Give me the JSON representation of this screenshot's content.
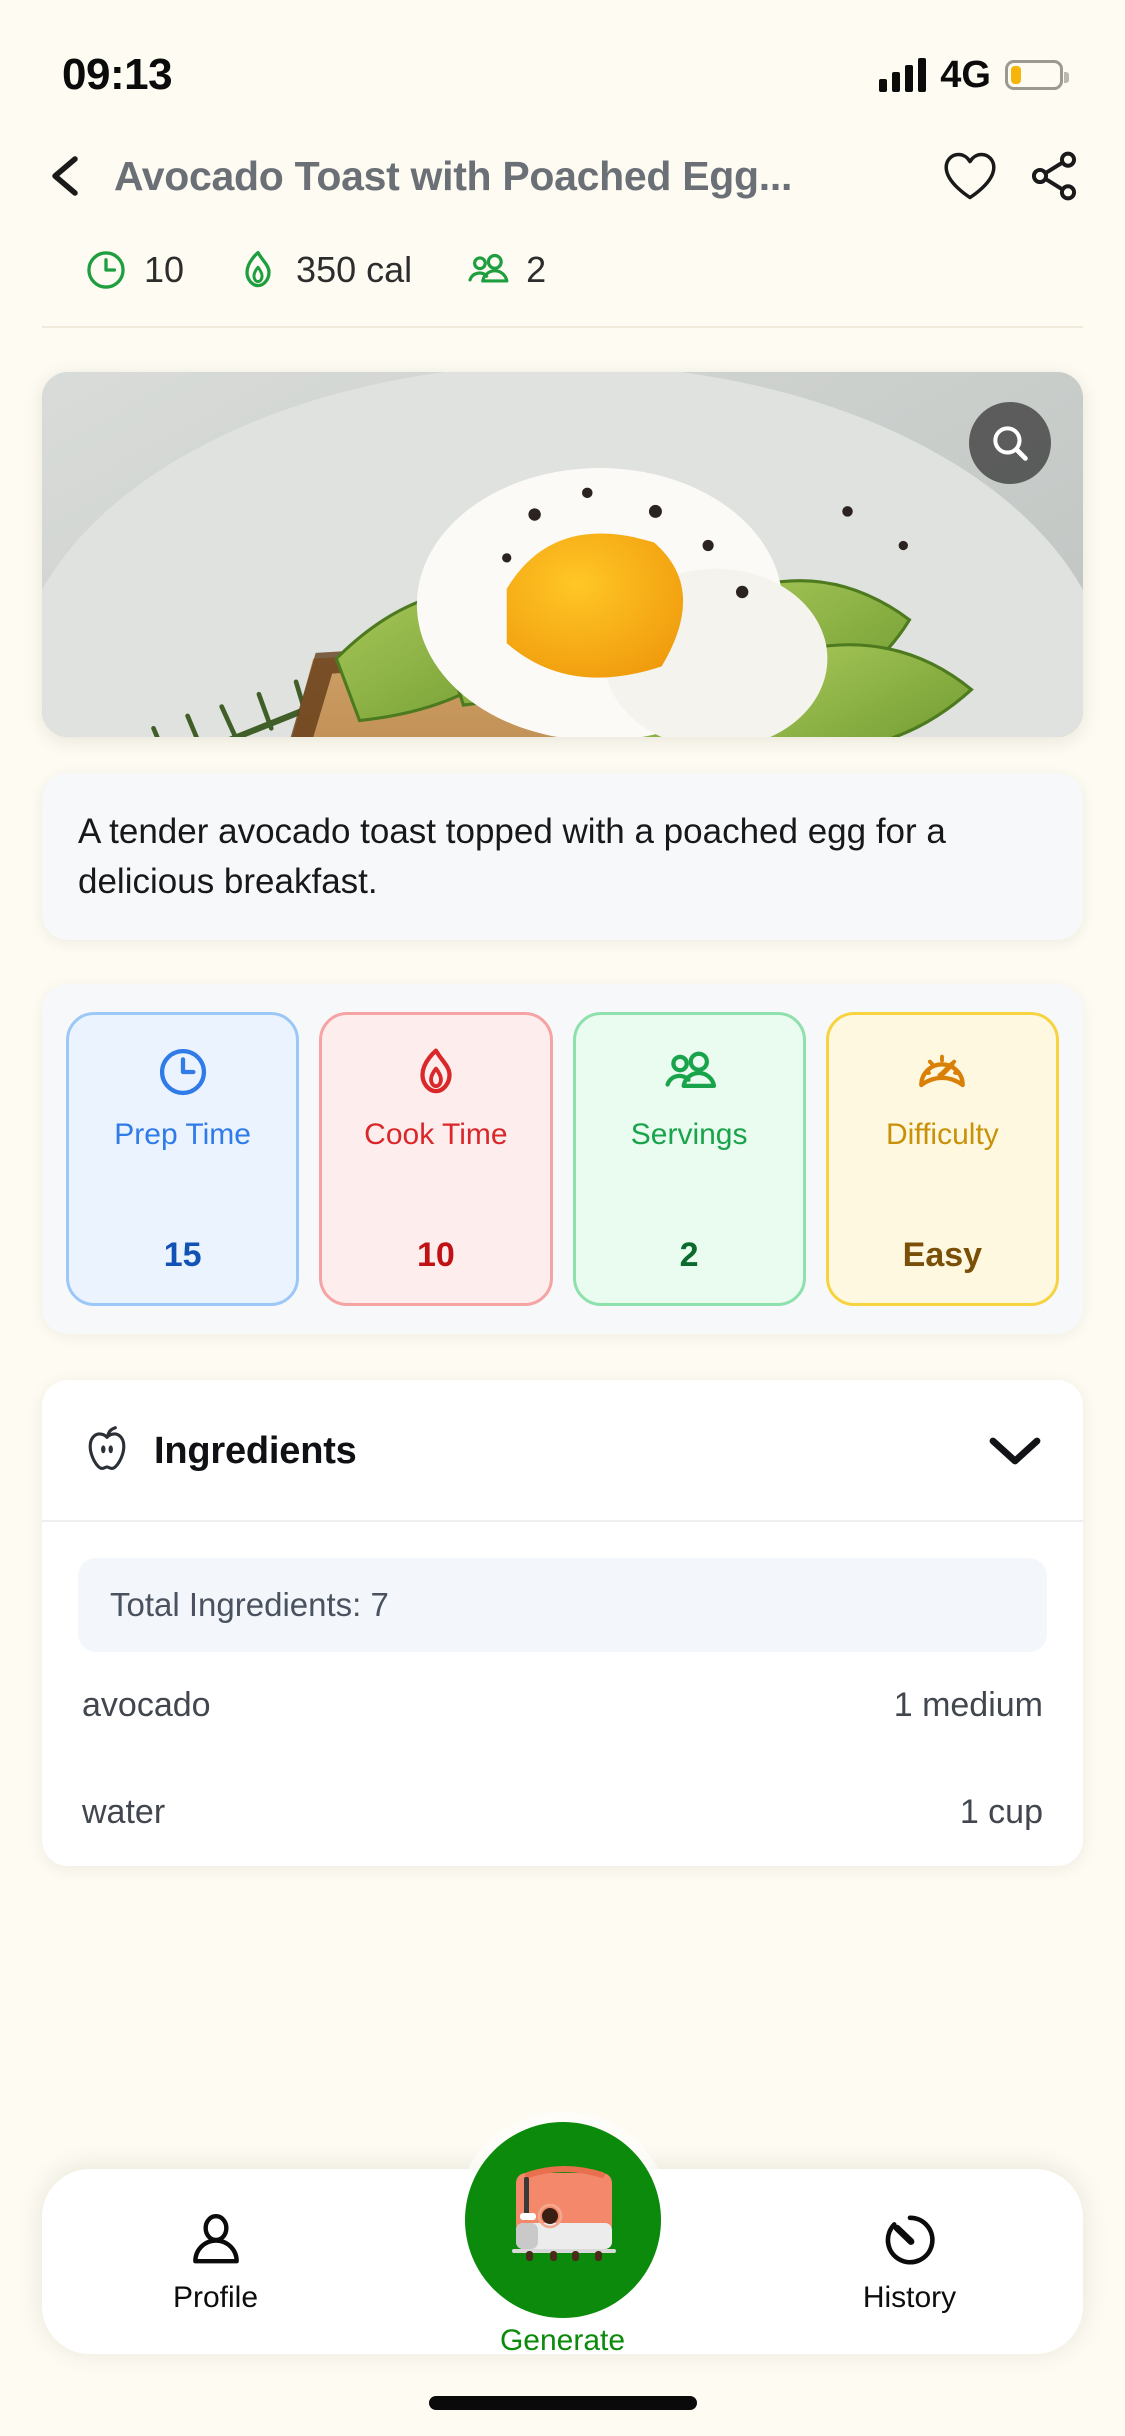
{
  "status_bar": {
    "time": "09:13",
    "network": "4G",
    "signal_icon": "signal-bars-icon",
    "battery_icon": "battery-low-icon",
    "battery_level_percent": 22
  },
  "header": {
    "back_icon": "chevron-left-icon",
    "title": "Avocado Toast with Poached Egg...",
    "favorite_icon": "heart-outline-icon",
    "share_icon": "share-icon",
    "quick_stats": [
      {
        "icon": "clock-icon",
        "value": "10"
      },
      {
        "icon": "flame-icon",
        "value": "350 cal"
      },
      {
        "icon": "people-icon",
        "value": "2"
      }
    ]
  },
  "hero": {
    "image_alt": "avocado-toast-poached-egg-photo",
    "search_icon": "search-icon"
  },
  "description": {
    "text": "A tender avocado toast topped with a poached egg for a delicious breakfast."
  },
  "metrics": [
    {
      "icon": "clock-icon",
      "label": "Prep Time",
      "value": "15",
      "theme": "blue",
      "color": "#2F7BE8"
    },
    {
      "icon": "flame-icon",
      "label": "Cook Time",
      "value": "10",
      "theme": "red",
      "color": "#D9272A"
    },
    {
      "icon": "people-icon",
      "label": "Servings",
      "value": "2",
      "theme": "green",
      "color": "#19A44B"
    },
    {
      "icon": "gauge-icon",
      "label": "Difficulty",
      "value": "Easy",
      "theme": "yellow",
      "color": "#C99109"
    }
  ],
  "ingredients_section": {
    "icon": "apple-icon",
    "title": "Ingredients",
    "toggle_icon": "chevron-down-icon",
    "total_label": "Total Ingredients: 7",
    "rows": [
      {
        "name": "avocado",
        "amount": "1 medium"
      },
      {
        "name": "water",
        "amount": "1 cup"
      }
    ]
  },
  "bottom_nav": {
    "items": [
      {
        "icon": "person-icon",
        "label": "Profile"
      },
      {
        "icon": "history-icon",
        "label": "History"
      }
    ],
    "center": {
      "icon": "toaster-icon",
      "label": "Generate",
      "color": "#0B8A0B"
    }
  },
  "colors": {
    "page_background": "#FDFBF2",
    "accent_green": "#0B8A0B",
    "title_gray": "#6B7076"
  }
}
